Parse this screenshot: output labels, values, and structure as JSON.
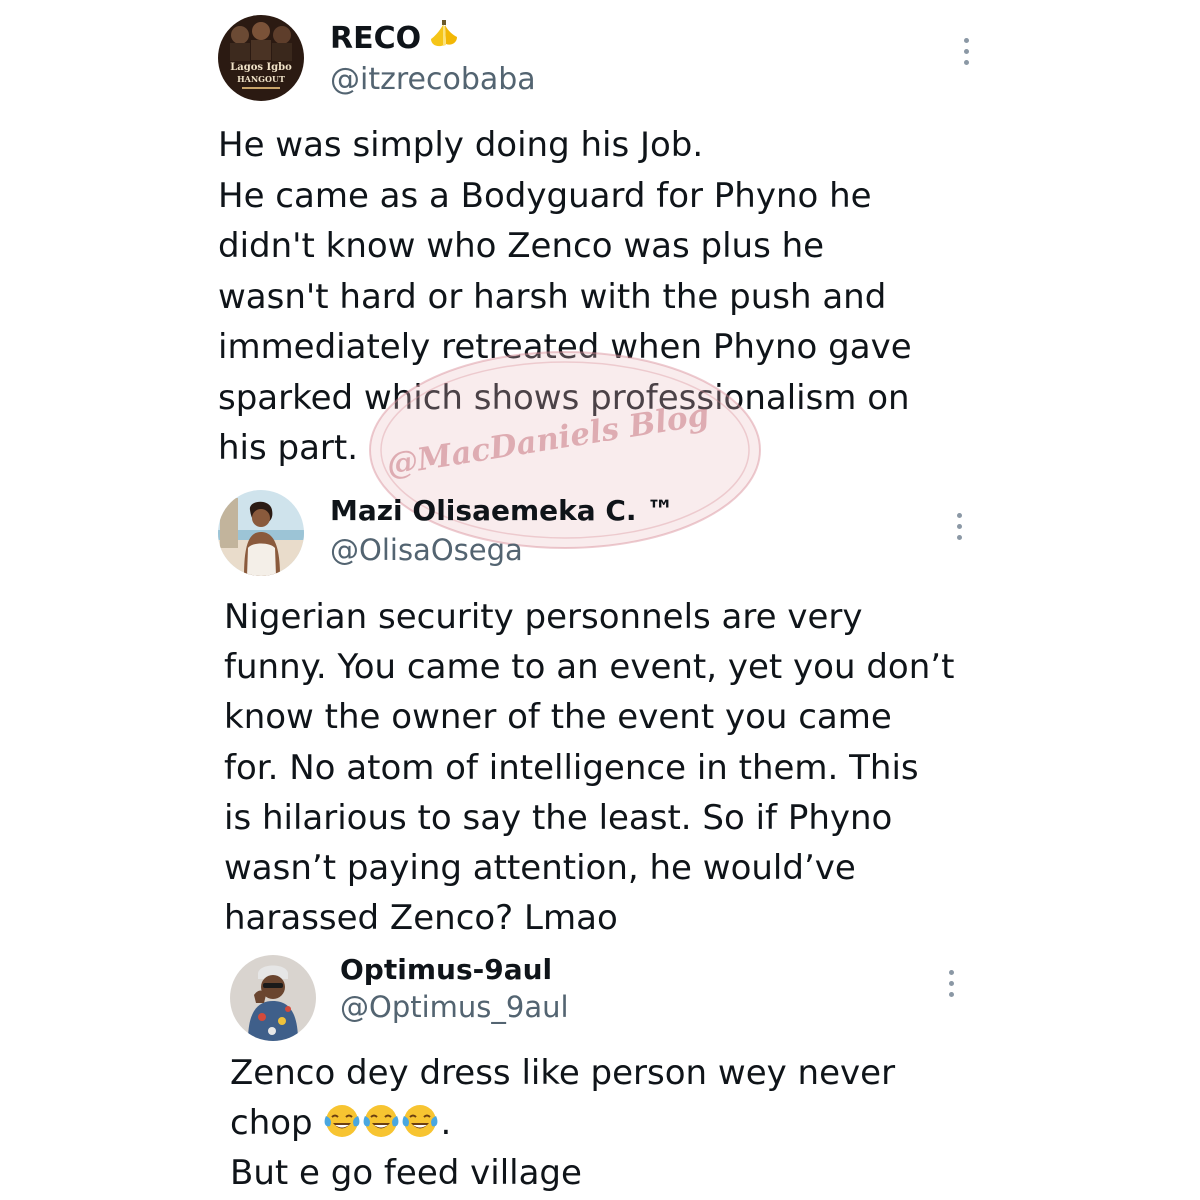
{
  "watermark": {
    "text": "@MacDaniels Blog"
  },
  "tweets": [
    {
      "name": "RECO",
      "name_emoji": "banana",
      "handle": "@itzrecobaba",
      "avatar_text": {
        "line1": "Lagos Igbo",
        "line2": "HANGOUT"
      },
      "body_lines": [
        "He was simply doing his Job.",
        "He came as a Bodyguard for Phyno he",
        "didn't know who Zenco was plus he",
        "wasn't hard or harsh with the push and",
        "immediately retreated when Phyno gave",
        "sparked which shows professionalism on",
        "his part."
      ]
    },
    {
      "name": "Mazi Olisaemeka C. ™",
      "handle": "@OlisaOsega",
      "body_lines": [
        "Nigerian security personnels are very",
        "funny. You came to an event, yet you don’t",
        "know the owner of the event you came",
        "for. No atom of intelligence in them. This",
        "is hilarious to say the least. So if Phyno",
        "wasn’t paying attention, he would’ve",
        "harassed Zenco? Lmao"
      ]
    },
    {
      "name": "Optimus-9aul",
      "handle": "@Optimus_9aul",
      "body_lines": [
        "Zenco dey dress like person wey never",
        "chop",
        ".",
        "But e go feed village"
      ],
      "emojis": [
        "face-with-tears-of-joy",
        "face-with-tears-of-joy",
        "face-with-tears-of-joy"
      ]
    }
  ],
  "colors": {
    "text": "#0f1419",
    "handle": "#536471",
    "more_icon": "#8b98a5",
    "watermark": "#e8b4b8",
    "banana": "#f5c518",
    "emoji_face": "#f7c431",
    "emoji_tears": "#4aa7e0"
  }
}
